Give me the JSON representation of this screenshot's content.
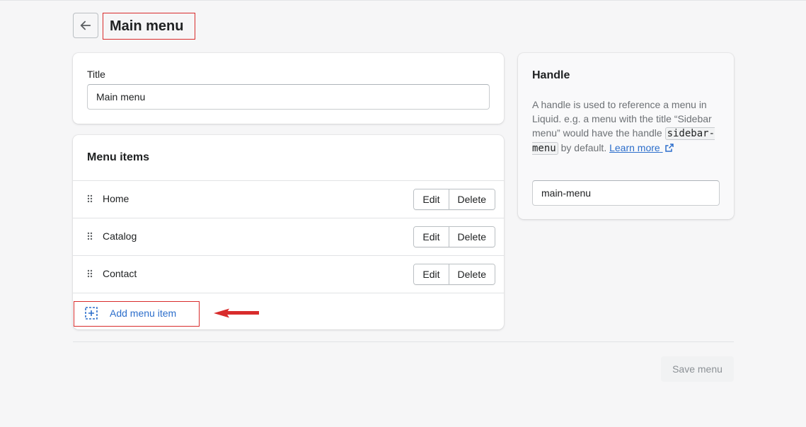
{
  "header": {
    "back_icon": "arrow-left-icon",
    "title": "Main menu"
  },
  "title_card": {
    "label": "Title",
    "value": "Main menu"
  },
  "menu_items_card": {
    "heading": "Menu items",
    "items": [
      {
        "label": "Home",
        "edit_label": "Edit",
        "delete_label": "Delete"
      },
      {
        "label": "Catalog",
        "edit_label": "Edit",
        "delete_label": "Delete"
      },
      {
        "label": "Contact",
        "edit_label": "Edit",
        "delete_label": "Delete"
      }
    ],
    "add_label": "Add menu item",
    "add_icon": "add-dashed-square-icon"
  },
  "handle_card": {
    "heading": "Handle",
    "description_before": "A handle is used to reference a menu in Liquid. e.g. a menu with the title “Sidebar menu” would have the handle ",
    "description_code": "sidebar-menu",
    "description_after": " by default. ",
    "learn_more": "Learn more",
    "value": "main-menu"
  },
  "footer": {
    "save_label": "Save menu"
  },
  "colors": {
    "accent": "#2c6ecb",
    "annotation": "#d82c2c",
    "background": "#f6f6f7"
  }
}
